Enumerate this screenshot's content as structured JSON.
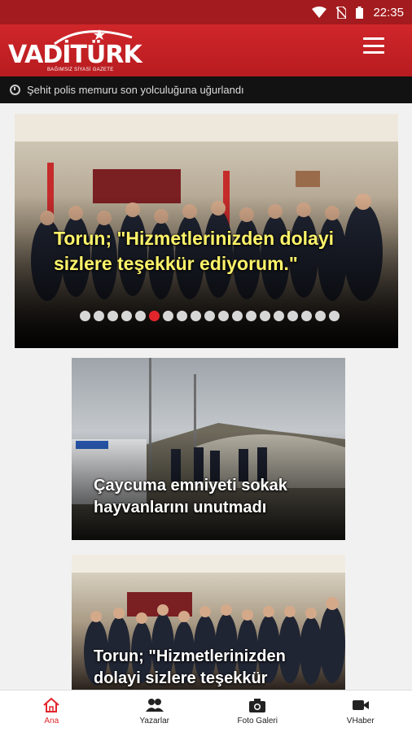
{
  "status_bar": {
    "time": "22:35",
    "icons": [
      "wifi-icon",
      "no-sim-icon",
      "battery-icon"
    ]
  },
  "header": {
    "logo_text": "VADİTÜRK",
    "logo_subtitle": "BAĞIMSIZ SİYASİ GAZETE",
    "menu_icon": "hamburger-icon"
  },
  "ticker": {
    "icon": "clock-icon",
    "text": "Şehit polis memuru son yolculuğuna uğurlandı"
  },
  "slider": {
    "headline": "Torun; \"Hizmetlerinizden dolayi sizlere teşekkür ediyorum.\"",
    "dot_count": 19,
    "active_dot": 5
  },
  "cards": [
    {
      "headline": "Çaycuma emniyeti sokak hayvanlarını unutmadı"
    },
    {
      "headline": "Torun; \"Hizmetlerinizden dolayi sizlere teşekkür"
    }
  ],
  "bottom_nav": [
    {
      "label": "Ana",
      "icon": "home-icon",
      "active": true
    },
    {
      "label": "Yazarlar",
      "icon": "people-icon",
      "active": false
    },
    {
      "label": "Foto Galeri",
      "icon": "camera-icon",
      "active": false
    },
    {
      "label": "VHaber",
      "icon": "video-camera-icon",
      "active": false
    }
  ],
  "colors": {
    "brand_red": "#d0262a",
    "accent_yellow": "#fff46a",
    "active_nav": "#e0262b"
  }
}
